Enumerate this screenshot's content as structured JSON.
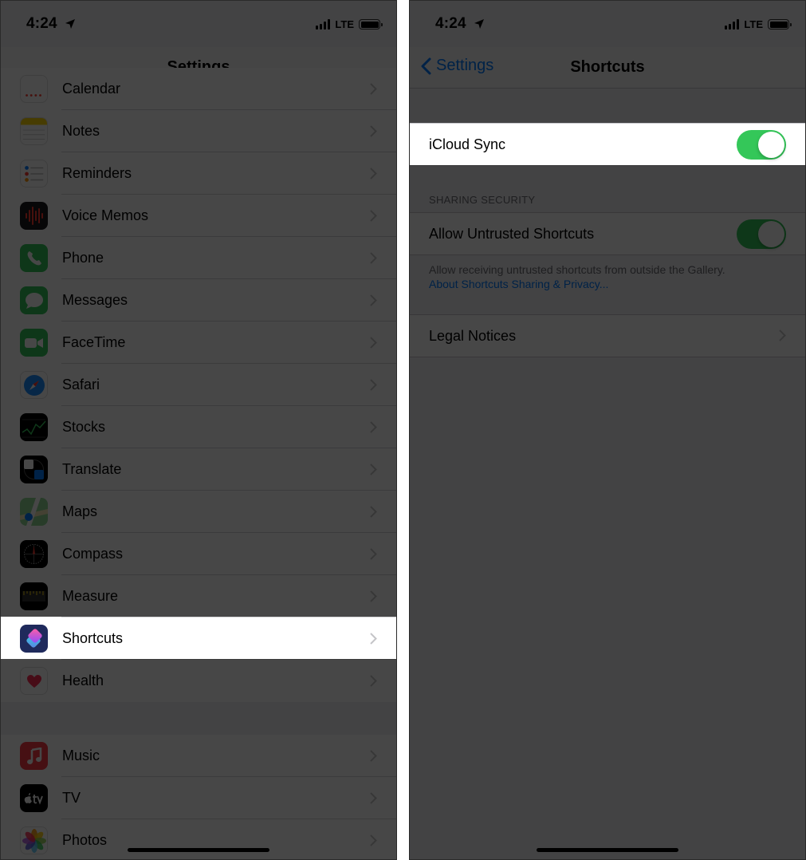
{
  "left_screen": {
    "status_bar": {
      "time": "4:24",
      "network": "LTE"
    },
    "nav_title": "Settings",
    "group1": [
      {
        "label": "Calendar",
        "icon": "calendar-icon"
      },
      {
        "label": "Notes",
        "icon": "notes-icon"
      },
      {
        "label": "Reminders",
        "icon": "reminders-icon"
      },
      {
        "label": "Voice Memos",
        "icon": "voice-memos-icon"
      },
      {
        "label": "Phone",
        "icon": "phone-icon"
      },
      {
        "label": "Messages",
        "icon": "messages-icon"
      },
      {
        "label": "FaceTime",
        "icon": "facetime-icon"
      },
      {
        "label": "Safari",
        "icon": "safari-icon"
      },
      {
        "label": "Stocks",
        "icon": "stocks-icon"
      },
      {
        "label": "Translate",
        "icon": "translate-icon"
      },
      {
        "label": "Maps",
        "icon": "maps-icon"
      },
      {
        "label": "Compass",
        "icon": "compass-icon"
      },
      {
        "label": "Measure",
        "icon": "measure-icon"
      },
      {
        "label": "Shortcuts",
        "icon": "shortcuts-icon",
        "highlighted": true
      },
      {
        "label": "Health",
        "icon": "health-icon"
      }
    ],
    "group2": [
      {
        "label": "Music",
        "icon": "music-icon"
      },
      {
        "label": "TV",
        "icon": "tv-icon"
      },
      {
        "label": "Photos",
        "icon": "photos-icon"
      }
    ]
  },
  "right_screen": {
    "status_bar": {
      "time": "4:24",
      "network": "LTE"
    },
    "back_label": "Settings",
    "nav_title": "Shortcuts",
    "icloud_sync": {
      "label": "iCloud Sync",
      "on": true
    },
    "sharing_security_header": "SHARING SECURITY",
    "allow_untrusted": {
      "label": "Allow Untrusted Shortcuts",
      "on": true
    },
    "footer_text": "Allow receiving untrusted shortcuts from outside the Gallery.",
    "footer_link": "About Shortcuts Sharing & Privacy...",
    "legal_notices": "Legal Notices"
  },
  "colors": {
    "accent": "#007aff",
    "toggle_on": "#34c759",
    "overlay": "rgba(0,0,0,0.72)"
  }
}
